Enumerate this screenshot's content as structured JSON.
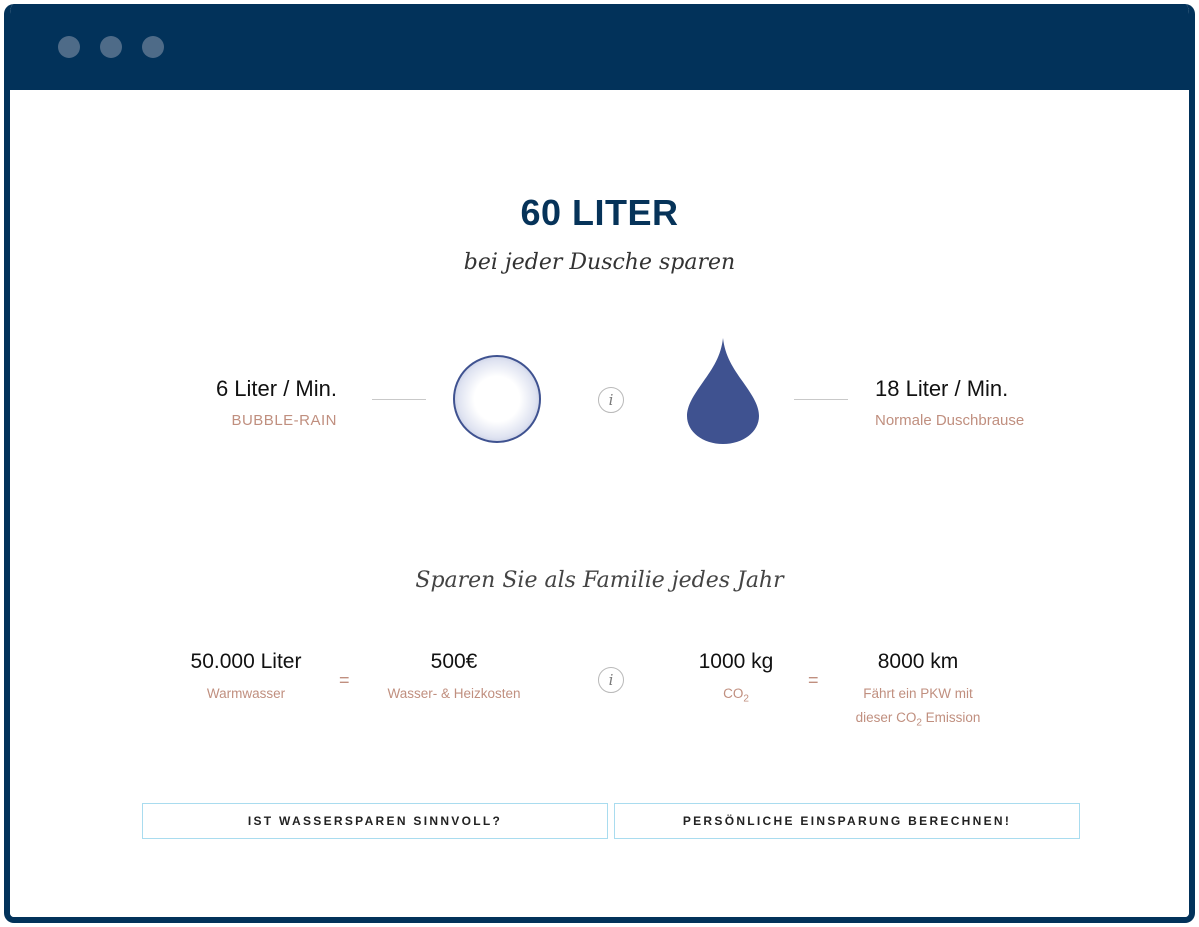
{
  "hero": {
    "headline": "60 LITER",
    "subline": "bei jeder Dusche sparen"
  },
  "comparison": {
    "left": {
      "value": "6 Liter / Min.",
      "label": "BUBBLE-RAIN",
      "icon": "bubble-icon"
    },
    "right": {
      "value": "18 Liter / Min.",
      "label": "Normale Duschbrause",
      "icon": "water-drop-icon"
    },
    "info_icon": "i"
  },
  "family": {
    "heading": "Sparen Sie als Familie jedes Jahr",
    "info_icon": "i",
    "equals_sign": "=",
    "stats": [
      {
        "value": "50.000 Liter",
        "label_main": "Warmwasser"
      },
      {
        "value": "500€",
        "label_main": "Wasser- & Heizkosten"
      },
      {
        "value": "1000 kg",
        "label_main": "CO",
        "label_sub": "2"
      },
      {
        "value": "8000 km",
        "label_line1": "Fährt ein PKW mit",
        "label_line2_pre": "dieser CO",
        "label_line2_sub": "2",
        "label_line2_post": " Emission"
      }
    ]
  },
  "buttons": {
    "left_label": "IST WASSERSPAREN SINNVOLL?",
    "right_label": "PERSÖNLICHE EINSPARUNG BERECHNEN!"
  },
  "colors": {
    "navy": "#02325a",
    "accent_text": "#c08f7f",
    "drop_blue": "#3f5290",
    "button_border": "#a9dcef"
  }
}
